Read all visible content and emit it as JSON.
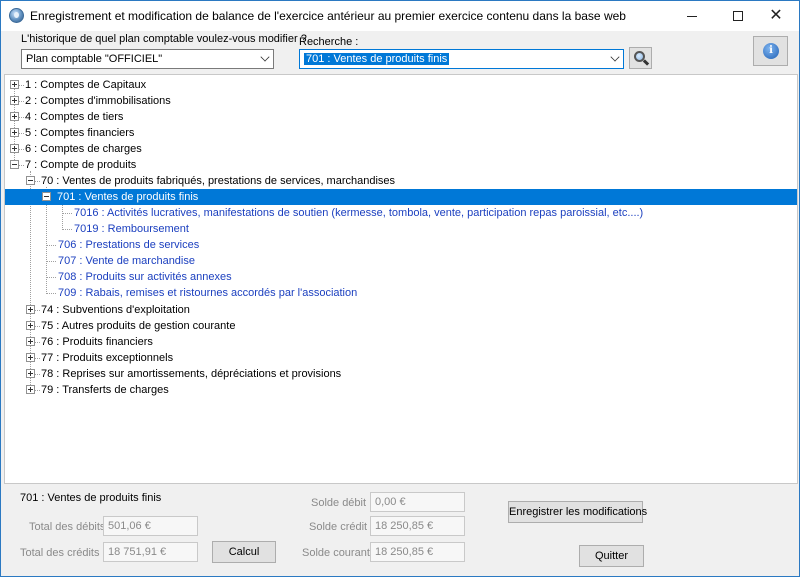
{
  "window": {
    "title": "Enregistrement et modification de balance de l'exercice antérieur au premier exercice contenu dans la base web"
  },
  "top": {
    "plan_label": "L'historique de quel plan comptable voulez-vous modifier ?",
    "plan_value": "Plan comptable \"OFFICIEL\"",
    "search_label": "Recherche :",
    "search_value": "701 : Ventes de produits finis",
    "info_glyph": "i"
  },
  "tree": {
    "nodes": [
      {
        "label": "1 : Comptes de Capitaux"
      },
      {
        "label": "2 : Comptes d'immobilisations"
      },
      {
        "label": "4 : Comptes de tiers"
      },
      {
        "label": "5 : Comptes financiers"
      },
      {
        "label": "6 : Comptes de charges"
      },
      {
        "label": "7 : Compte de produits"
      },
      {
        "label": "70 : Ventes de produits fabriqués, prestations de services, marchandises"
      },
      {
        "label": "701 : Ventes de produits finis"
      },
      {
        "label": "7016 : Activités lucratives, manifestations de soutien (kermesse, tombola, vente, participation repas paroissial, etc....)"
      },
      {
        "label": "7019 : Remboursement"
      },
      {
        "label": "706 : Prestations de services"
      },
      {
        "label": "707 : Vente de marchandise"
      },
      {
        "label": "708 : Produits sur activités annexes"
      },
      {
        "label": "709 : Rabais, remises et ristournes accordés par l'association"
      },
      {
        "label": "74 : Subventions d'exploitation"
      },
      {
        "label": "75 : Autres produits de gestion courante"
      },
      {
        "label": "76 : Produits financiers"
      },
      {
        "label": "77 : Produits exceptionnels"
      },
      {
        "label": "78 : Reprises sur amortissements, dépréciations et provisions"
      },
      {
        "label": "79 : Transferts de charges"
      }
    ]
  },
  "bottom": {
    "selected_account": "701 : Ventes de produits finis",
    "total_debits_label": "Total des débits :",
    "total_debits_value": "501,06 €",
    "total_credits_label": "Total des crédits :",
    "total_credits_value": "18 751,91 €",
    "calcul_label": "Calcul",
    "solde_debit_label": "Solde débit :",
    "solde_debit_value": "0,00 €",
    "solde_credit_label": "Solde crédit :",
    "solde_credit_value": "18 250,85 €",
    "solde_courant_label": "Solde courant :",
    "solde_courant_value": "18 250,85 €",
    "save_label": "Enregistrer les modifications",
    "quit_label": "Quitter"
  },
  "colors": {
    "accent": "#0078d7",
    "leaf_text": "#1b3fbf"
  }
}
